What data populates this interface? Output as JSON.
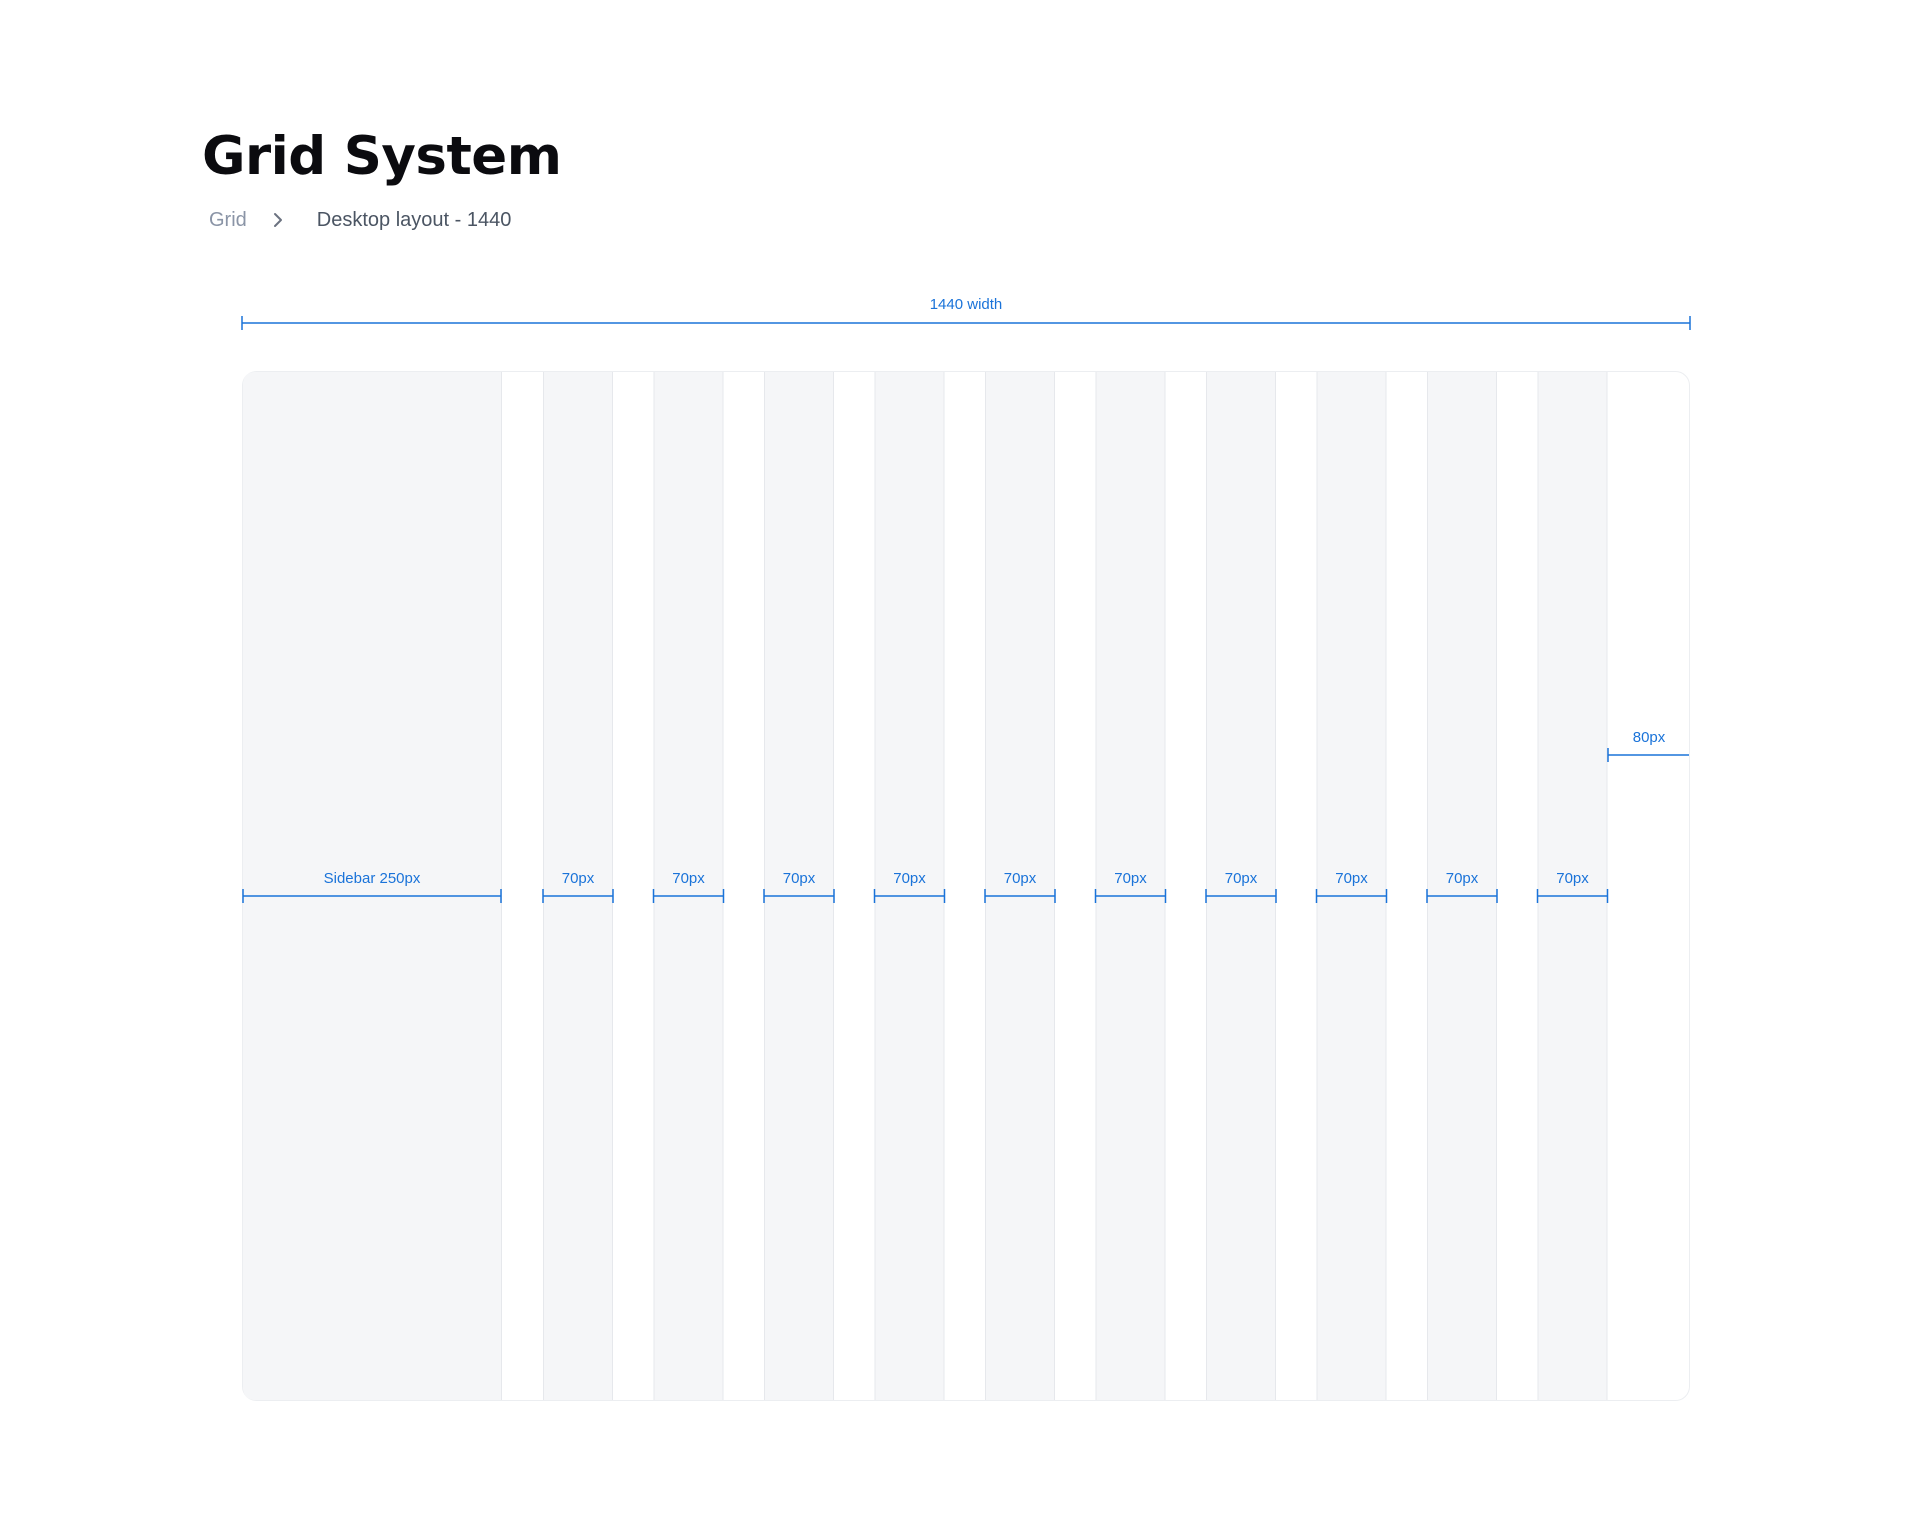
{
  "page": {
    "title": "Grid System"
  },
  "breadcrumb": {
    "items": [
      "Grid",
      "Desktop layout - 1440"
    ],
    "separator_icon": "chevron-right-icon"
  },
  "colors": {
    "accent": "#1a73d9",
    "column_fill": "#f5f6f8",
    "border": "#e6e8ec",
    "title": "#0b0b0f",
    "breadcrumb_root": "#8a94a6",
    "breadcrumb_current": "#4b5563"
  },
  "grid": {
    "total_label": "1440 width",
    "sidebar_label": "Sidebar 250px",
    "column_label": "70px",
    "column_count": 10,
    "margin_label": "80px"
  }
}
